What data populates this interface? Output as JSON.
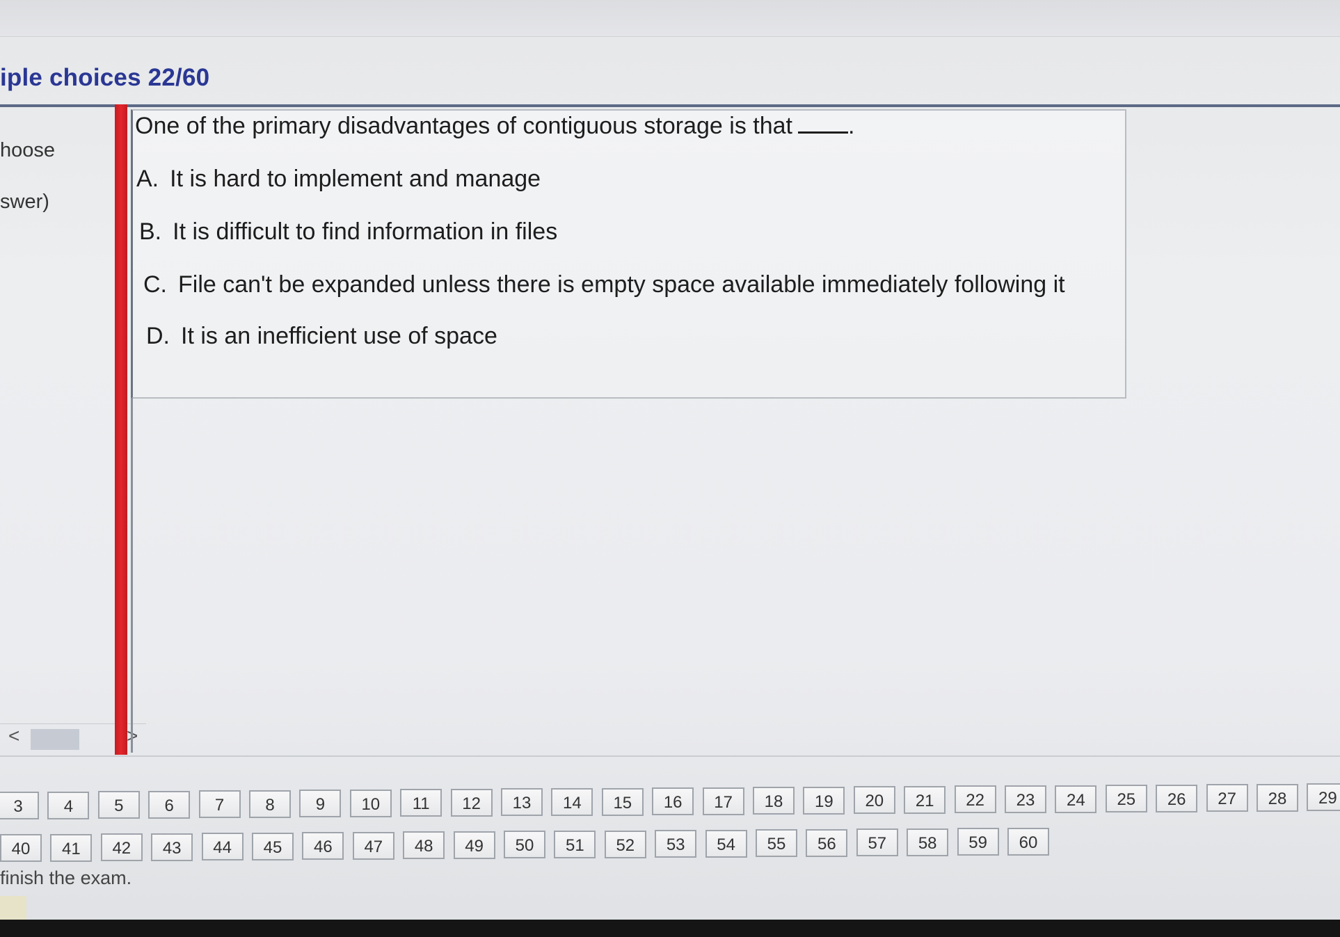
{
  "header": {
    "title": "iple choices 22/60"
  },
  "left_panel": {
    "text1": "hoose",
    "text2": "swer)",
    "scroll_left": "<",
    "scroll_right": ">"
  },
  "question": {
    "text": "One of the primary disadvantages of contiguous storage is that",
    "blank_suffix": "."
  },
  "options": [
    {
      "letter": "A.",
      "text": "It is hard to implement and manage"
    },
    {
      "letter": "B.",
      "text": "It is difficult to find information in files"
    },
    {
      "letter": "C.",
      "text": "File can't be expanded unless there is empty space available immediately following it"
    },
    {
      "letter": "D.",
      "text": "It is an inefficient use of space"
    }
  ],
  "nav": {
    "row1": [
      "3",
      "4",
      "5",
      "6",
      "7",
      "8",
      "9",
      "10",
      "11",
      "12",
      "13",
      "14",
      "15",
      "16",
      "17",
      "18",
      "19",
      "20",
      "21",
      "22",
      "23",
      "24",
      "25",
      "26",
      "27",
      "28",
      "29"
    ],
    "row2": [
      "40",
      "41",
      "42",
      "43",
      "44",
      "45",
      "46",
      "47",
      "48",
      "49",
      "50",
      "51",
      "52",
      "53",
      "54",
      "55",
      "56",
      "57",
      "58",
      "59",
      "60"
    ]
  },
  "footer": {
    "finish_text": "finish the exam."
  }
}
